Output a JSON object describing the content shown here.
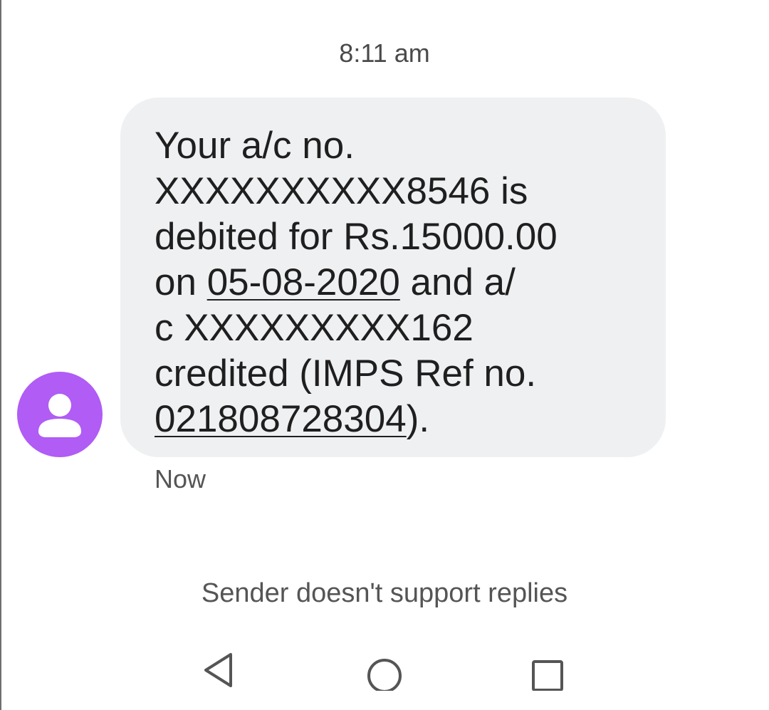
{
  "conversation": {
    "timestamp_header": "8:11 am",
    "message": {
      "lines": [
        "Your a/c no.",
        "XXXXXXXXXX8546 is",
        "debited for Rs.15000.00",
        "on ",
        "05-08-2020",
        " and a/",
        "c XXXXXXXXX162",
        "credited (IMPS Ref no.",
        "021808728304",
        ")."
      ],
      "time": "Now"
    },
    "sender_avatar": "person-icon",
    "reply_notice": "Sender doesn't support replies"
  },
  "navigation": {
    "back_icon": "back-triangle-icon",
    "home_icon": "home-circle-icon",
    "recents_icon": "recents-square-icon"
  },
  "colors": {
    "avatar": "#b05cf5",
    "bubble": "#eff0f2",
    "text": "#1f1f1f",
    "secondary_text": "#555555"
  }
}
